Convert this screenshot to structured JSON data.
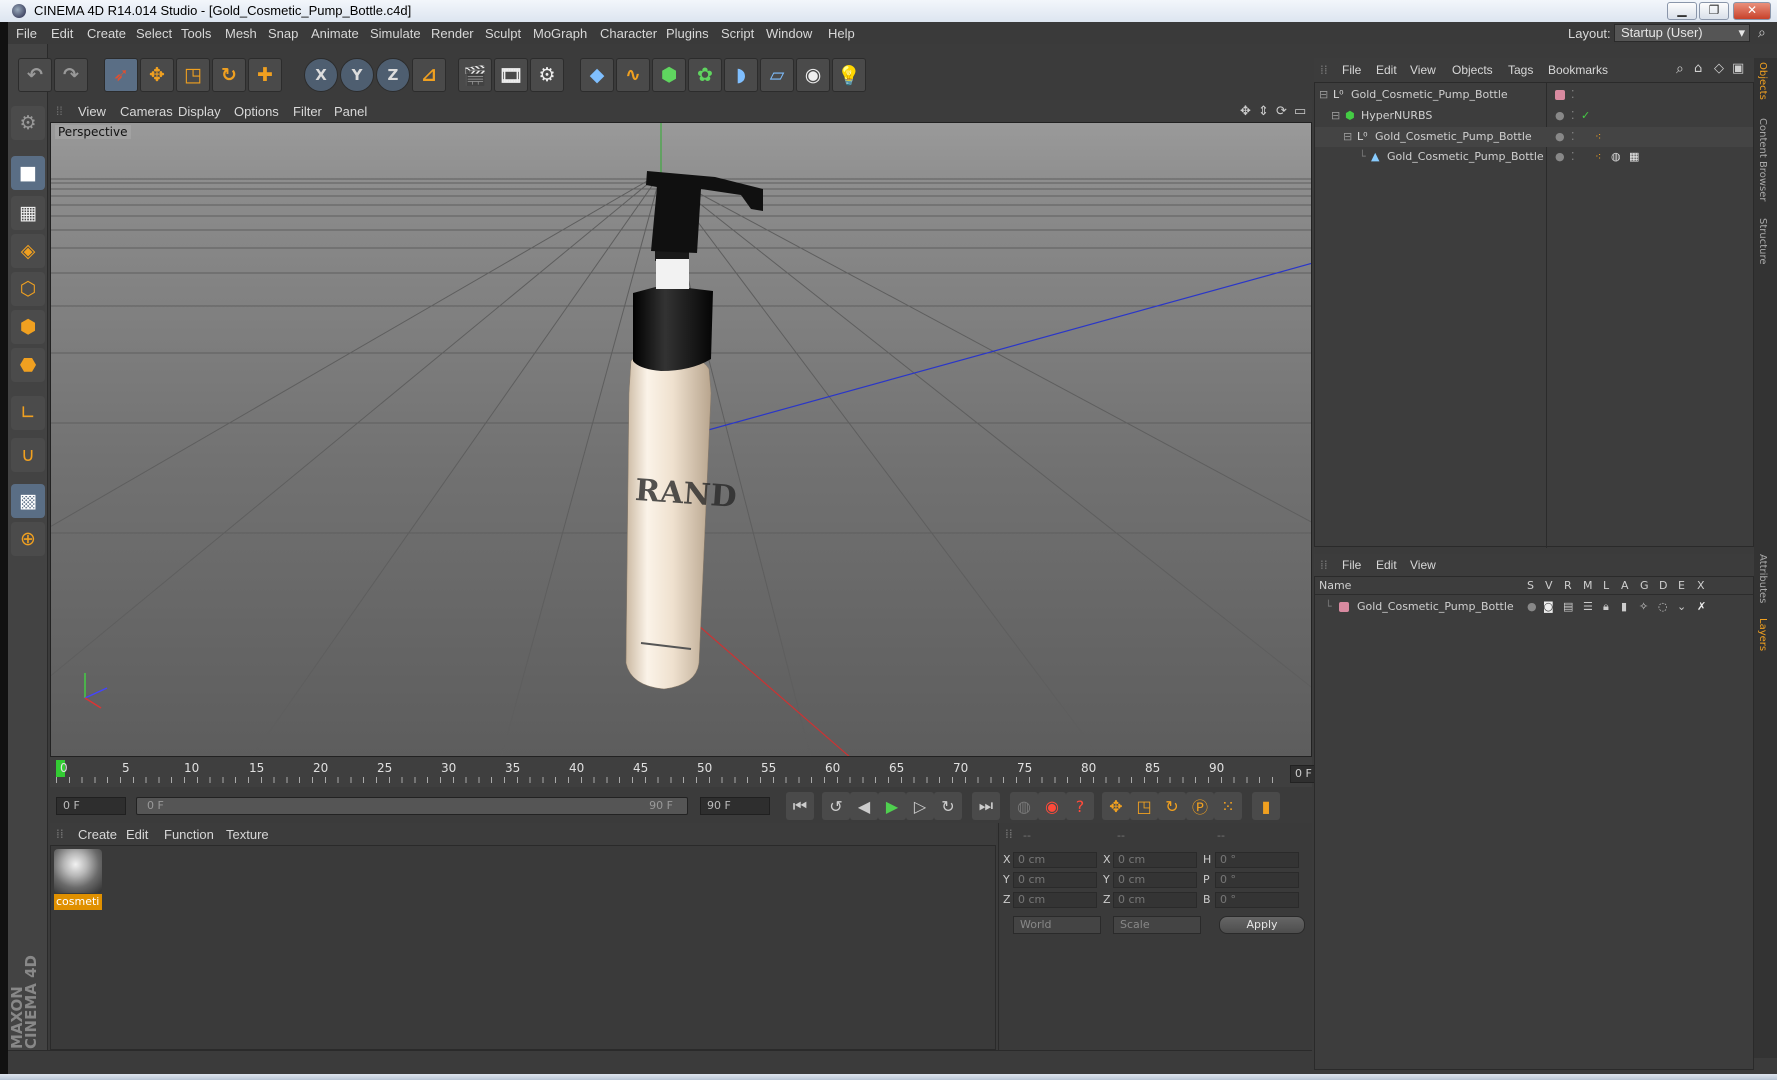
{
  "window": {
    "title": "CINEMA 4D R14.014 Studio - [Gold_Cosmetic_Pump_Bottle.c4d]"
  },
  "menubar": {
    "items": [
      "File",
      "Edit",
      "Create",
      "Select",
      "Tools",
      "Mesh",
      "Snap",
      "Animate",
      "Simulate",
      "Render",
      "Sculpt",
      "MoGraph",
      "Character",
      "Plugins",
      "Script",
      "Window",
      "Help"
    ],
    "layout_label": "Layout:",
    "layout_value": "Startup (User)"
  },
  "viewport": {
    "menu": [
      "View",
      "Cameras",
      "Display",
      "Options",
      "Filter",
      "Panel"
    ],
    "label": "Perspective",
    "bottle_label": "RAND"
  },
  "timeline": {
    "ticks": [
      "0",
      "5",
      "10",
      "15",
      "20",
      "25",
      "30",
      "35",
      "40",
      "45",
      "50",
      "55",
      "60",
      "65",
      "70",
      "75",
      "80",
      "85",
      "90"
    ],
    "frame_indicator": "0 F"
  },
  "transport": {
    "current_frame": "0 F",
    "range_start": "0 F",
    "range_end": "90 F",
    "end_frame": "90 F"
  },
  "material_manager": {
    "menu": [
      "Create",
      "Edit",
      "Function",
      "Texture"
    ],
    "materials": [
      {
        "name": "cosmeti"
      }
    ]
  },
  "coordinates": {
    "headers": [
      "--",
      "--",
      "--"
    ],
    "rows": [
      {
        "a_label": "X",
        "a_value": "0 cm",
        "b_label": "X",
        "b_value": "0 cm",
        "c_label": "H",
        "c_value": "0 °"
      },
      {
        "a_label": "Y",
        "a_value": "0 cm",
        "b_label": "Y",
        "b_value": "0 cm",
        "c_label": "P",
        "c_value": "0 °"
      },
      {
        "a_label": "Z",
        "a_value": "0 cm",
        "b_label": "Z",
        "b_value": "0 cm",
        "c_label": "B",
        "c_value": "0 °"
      }
    ],
    "space_select": "World",
    "mode_select": "Scale",
    "apply_label": "Apply"
  },
  "object_manager": {
    "menu": [
      "File",
      "Edit",
      "View",
      "Objects",
      "Tags",
      "Bookmarks"
    ],
    "objects": [
      {
        "name": "Gold_Cosmetic_Pump_Bottle"
      },
      {
        "name": "HyperNURBS"
      },
      {
        "name": "Gold_Cosmetic_Pump_Bottle"
      },
      {
        "name": "Gold_Cosmetic_Pump_Bottle"
      }
    ]
  },
  "layer_manager": {
    "menu": [
      "File",
      "Edit",
      "View"
    ],
    "columns": [
      "Name",
      "S",
      "V",
      "R",
      "M",
      "L",
      "A",
      "G",
      "D",
      "E",
      "X"
    ],
    "layers": [
      {
        "name": "Gold_Cosmetic_Pump_Bottle"
      }
    ]
  },
  "side_tabs": [
    "Objects",
    "Content Browser",
    "Structure",
    "Attributes",
    "Layers"
  ],
  "brand": {
    "line1": "MAXON",
    "line2": "CINEMA 4D"
  },
  "colors": {
    "accent": "#f0a020",
    "viewport_top": "#9a9a9a",
    "viewport_bottom": "#5d5d5d",
    "layer_color": "#d88aa0"
  }
}
